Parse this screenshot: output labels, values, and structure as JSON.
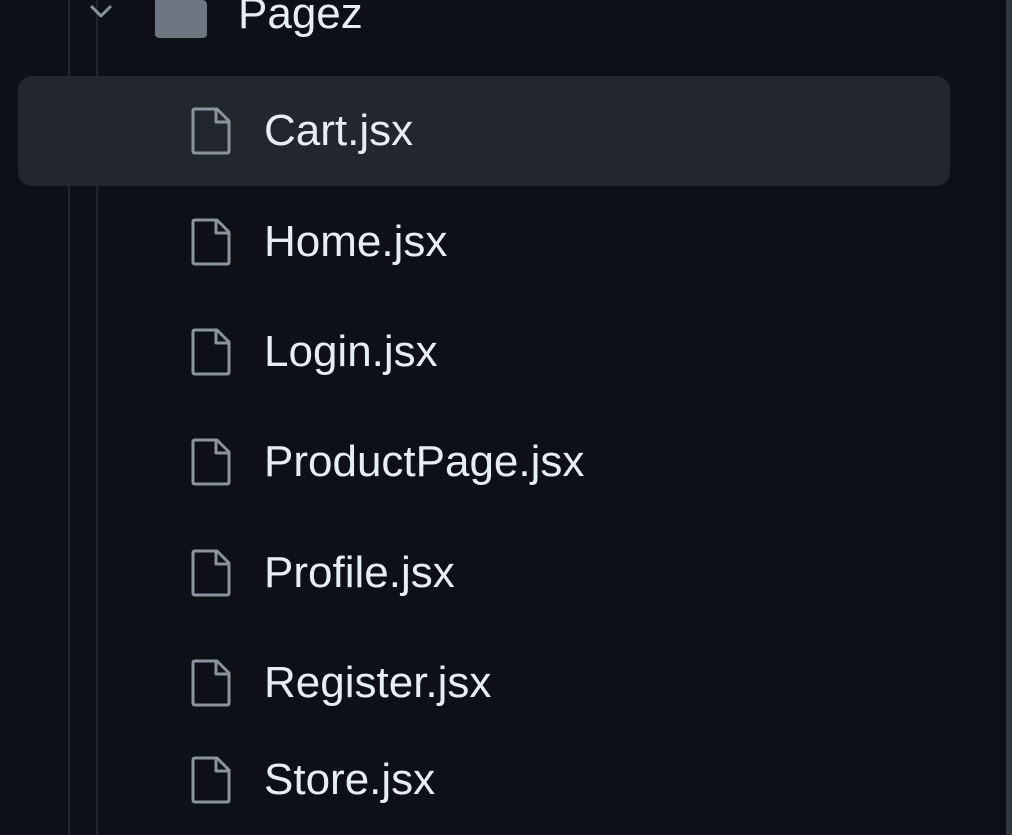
{
  "explorer": {
    "folder": {
      "label": "Pagez",
      "expanded": true,
      "icon": "folder-icon",
      "chevron": "chevron-down-icon"
    },
    "files": [
      {
        "label": "Cart.jsx",
        "icon": "file-icon",
        "selected": true
      },
      {
        "label": "Home.jsx",
        "icon": "file-icon",
        "selected": false
      },
      {
        "label": "Login.jsx",
        "icon": "file-icon",
        "selected": false
      },
      {
        "label": "ProductPage.jsx",
        "icon": "file-icon",
        "selected": false
      },
      {
        "label": "Profile.jsx",
        "icon": "file-icon",
        "selected": false
      },
      {
        "label": "Register.jsx",
        "icon": "file-icon",
        "selected": false
      },
      {
        "label": "Store.jsx",
        "icon": "file-icon",
        "selected": false
      }
    ]
  },
  "colors": {
    "background": "#0d1117",
    "selected_row": "#22272e",
    "text": "#e6edf3",
    "icon": "#8b949e"
  }
}
